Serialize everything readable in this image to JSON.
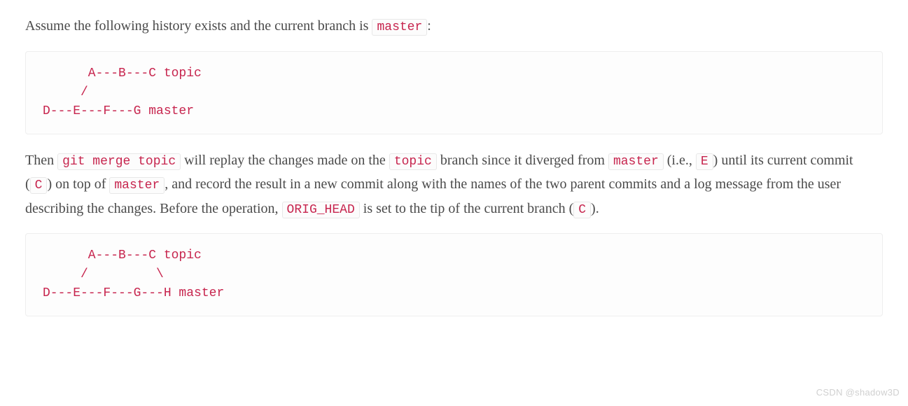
{
  "paragraph1": {
    "text_1": "Assume the following history exists and the current branch is ",
    "code_1": "master",
    "text_2": ":"
  },
  "codeblock1": "      A---B---C topic\n     /\nD---E---F---G master",
  "paragraph2": {
    "text_1": "Then ",
    "code_1": "git merge topic",
    "text_2": " will replay the changes made on the ",
    "code_2": "topic",
    "text_3": " branch since it diverged from ",
    "code_3": "master",
    "text_4": " (i.e., ",
    "code_4": "E",
    "text_5": ") until its current commit (",
    "code_5": "C",
    "text_6": ") on top of ",
    "code_6": "master",
    "text_7": ", and record the result in a new commit along with the names of the two parent commits and a log message from the user describing the changes. Before the operation, ",
    "code_7": "ORIG_HEAD",
    "text_8": " is set to the tip of the current branch (",
    "code_8": "C",
    "text_9": ")."
  },
  "codeblock2": "      A---B---C topic\n     /         \\\nD---E---F---G---H master",
  "watermark": "CSDN @shadow3D"
}
